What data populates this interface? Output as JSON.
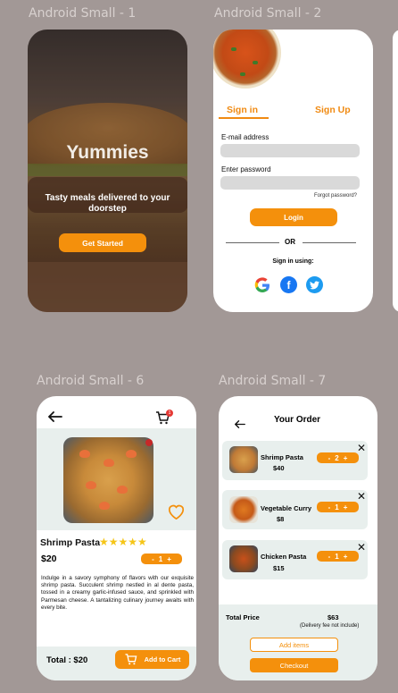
{
  "frames": {
    "s1": "Android Small - 1",
    "s2": "Android Small - 2",
    "s6": "Android Small - 6",
    "s7": "Android Small - 7"
  },
  "splash": {
    "title": "Yummies",
    "tagline": "Tasty meals delivered to your doorstep",
    "cta": "Get Started"
  },
  "auth": {
    "tab_signin": "Sign in",
    "tab_signup": "Sign Up",
    "email_label": "E-mail address",
    "password_label": "Enter password",
    "forgot": "Forgot password?",
    "login": "Login",
    "or": "OR",
    "sign_in_using": "Sign in using:",
    "social": [
      "google-icon",
      "facebook-icon",
      "twitter-icon"
    ]
  },
  "product": {
    "cart_count": "1",
    "name": "Shrimp Pasta",
    "rating": 5,
    "price": "$20",
    "qty": "1",
    "description": "Indulge in a savory symphony of flavors with our exquisite shrimp pasta. Succulent shrimp nestled in al dente pasta, tossed in a creamy garlic-infused sauce, and sprinkled with Parmesan cheese. A tantalizing culinary journey awaits with every bite.",
    "total": "Total : $20",
    "add_to_cart": "Add to Cart"
  },
  "order": {
    "title": "Your Order",
    "items": [
      {
        "name": "Shrimp Pasta",
        "price": "$40",
        "qty": "2"
      },
      {
        "name": "Vegetable Curry",
        "price": "$8",
        "qty": "1"
      },
      {
        "name": "Chicken Pasta",
        "price": "$15",
        "qty": "1"
      }
    ],
    "total_label": "Total Price",
    "total_value": "$63",
    "fee_note": "(Delivery fee not include)",
    "add_items": "Add items",
    "checkout": "Checkout"
  },
  "colors": {
    "accent": "#f4900c",
    "canvas": "#a29896",
    "panel": "#e8efed"
  }
}
